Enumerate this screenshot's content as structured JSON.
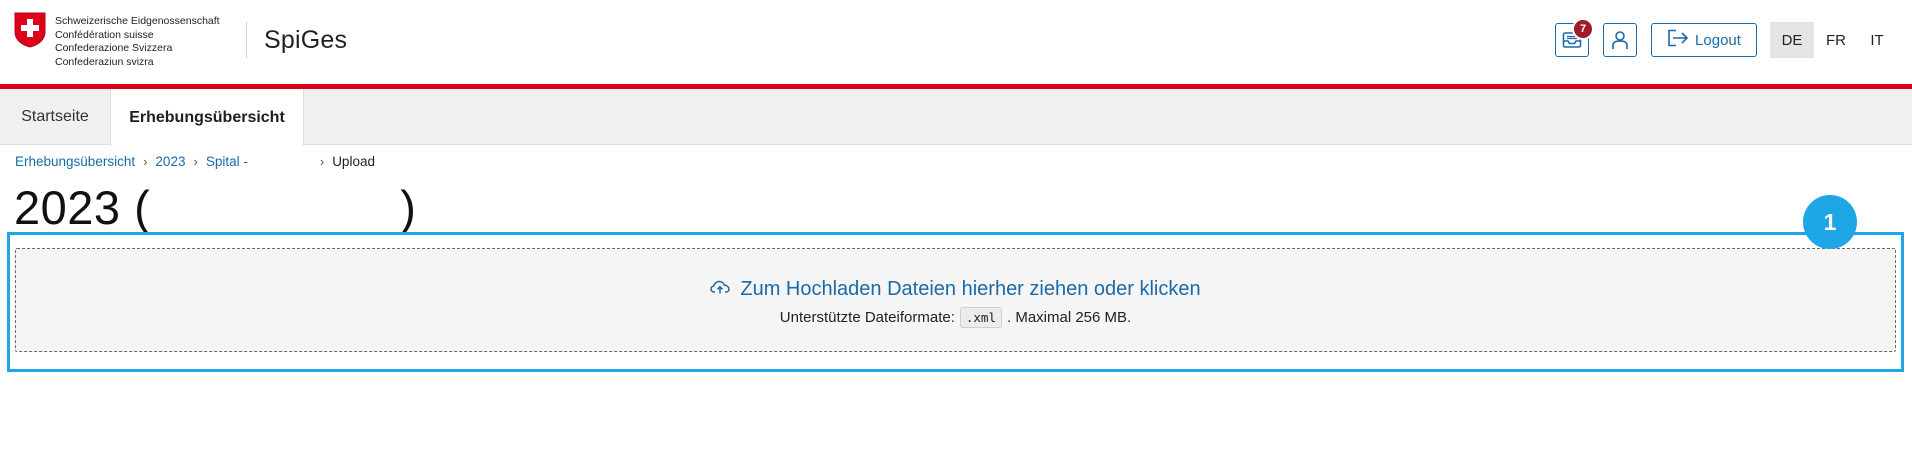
{
  "header": {
    "confederation_lines": [
      "Schweizerische Eidgenossenschaft",
      "Confédération suisse",
      "Confederazione Svizzera",
      "Confederaziun svizra"
    ],
    "app_name": "SpiGes",
    "inbox_badge_count": "7",
    "logout_label": "Logout",
    "languages": [
      "DE",
      "FR",
      "IT"
    ],
    "active_language": "DE"
  },
  "tabs": [
    {
      "label": "Startseite",
      "active": false
    },
    {
      "label": "Erhebungsübersicht",
      "active": true
    }
  ],
  "breadcrumb": {
    "items": [
      "Erhebungsübersicht",
      "2023",
      "Spital -"
    ],
    "current": "Upload",
    "separator": "›"
  },
  "page": {
    "title_start": "2023 (",
    "title_end": ")"
  },
  "upload": {
    "main_text": "Zum Hochladen Dateien hierher ziehen oder klicken",
    "formats_prefix": "Unterstützte Dateiformate:",
    "format": ".xml",
    "formats_suffix": ". Maximal 256 MB."
  },
  "annotation": {
    "step_number": "1"
  },
  "icons": {
    "inbox": "inbox-icon",
    "user": "user-icon",
    "logout": "logout-icon",
    "upload": "cloud-upload-icon",
    "logo": "swiss-cross-icon"
  },
  "colors": {
    "brand_red": "#dc0018",
    "link_blue": "#1a6aa8",
    "badge_red": "#9e1b2a",
    "highlight_blue": "#1ea6e6"
  }
}
